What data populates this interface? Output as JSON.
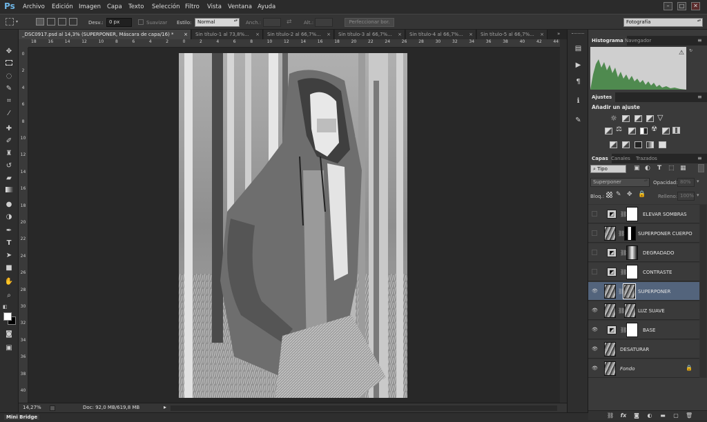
{
  "app": {
    "logo": "Ps"
  },
  "menu": [
    "Archivo",
    "Edición",
    "Imagen",
    "Capa",
    "Texto",
    "Selección",
    "Filtro",
    "Vista",
    "Ventana",
    "Ayuda"
  ],
  "window_controls": {
    "minimize": "–",
    "maximize": "□",
    "close": "✕"
  },
  "options_bar": {
    "feather_label": "Desv.:",
    "feather_value": "0 px",
    "antialias_label": "Suavizar",
    "style_label": "Estilo:",
    "style_value": "Normal",
    "width_label": "Anch.:",
    "height_label": "Alt.:",
    "refine_edge_button": "Perfeccionar bor.",
    "workspace_value": "Fotografía"
  },
  "doc_tabs": [
    {
      "label": "_DSC0917.psd al 14,3% (SUPERPONER, Máscara de capa/16) *",
      "close": "×"
    },
    {
      "label": "Sin título-1 al 73,8%...",
      "close": "×"
    },
    {
      "label": "Sin título-2 al 66,7%...",
      "close": "×"
    },
    {
      "label": "Sin título-3 al 66,7%...",
      "close": "×"
    },
    {
      "label": "Sin título-4 al 66,7%...",
      "close": "×"
    },
    {
      "label": "Sin título-5 al 66,7%...",
      "close": "×"
    }
  ],
  "ruler_h": [
    "18",
    "16",
    "14",
    "12",
    "10",
    "8",
    "6",
    "4",
    "2",
    "0",
    "2",
    "4",
    "6",
    "8",
    "10",
    "12",
    "14",
    "16",
    "18",
    "20",
    "22",
    "24",
    "26",
    "28",
    "30",
    "32",
    "34",
    "36",
    "38",
    "40",
    "42",
    "44"
  ],
  "ruler_v": [
    "0",
    "2",
    "4",
    "6",
    "8",
    "10",
    "12",
    "14",
    "16",
    "18",
    "20",
    "22",
    "24",
    "26",
    "28",
    "30",
    "32",
    "34",
    "36",
    "38",
    "40"
  ],
  "status": {
    "zoom": "14,27%",
    "doc_info": "Doc: 92,0 MB/619,8 MB"
  },
  "mini_bridge": "Mini Bridge",
  "histogram": {
    "tabs": [
      "Histograma",
      "Navegador"
    ],
    "warning": "⚠"
  },
  "adjustments": {
    "tab": "Ajustes",
    "title": "Añadir un ajuste",
    "row1": [
      "brightness-icon",
      "levels-icon",
      "curves-icon",
      "exposure-icon",
      "gradient-triangle-icon"
    ],
    "row2": [
      "vibrance-icon",
      "hue-icon",
      "color-balance-icon",
      "bw-icon",
      "photo-filter-icon",
      "channel-mixer-icon",
      "color-lookup-icon"
    ],
    "row3": [
      "invert-icon",
      "posterize-icon",
      "threshold-icon",
      "gradient-map-icon",
      "selective-color-icon"
    ]
  },
  "layers_panel": {
    "tabs": [
      "Capas",
      "Canales",
      "Trazados"
    ],
    "filter_kind": "Tipo",
    "blend_mode": "Superponer",
    "opacity_label": "Opacidad:",
    "opacity_value": "80%",
    "lock_label": "Bloq.:",
    "fill_label": "Relleno:",
    "fill_value": "100%",
    "layers": [
      {
        "name": "ELEVAR SOMBRAS",
        "visible": false,
        "kind": "adjustment"
      },
      {
        "name": "SUPERPONER CUERPO",
        "visible": false,
        "kind": "image"
      },
      {
        "name": "DEGRADADO",
        "visible": false,
        "kind": "adjustment"
      },
      {
        "name": "CONTRASTE",
        "visible": false,
        "kind": "adjustment"
      },
      {
        "name": "SUPERPONER",
        "visible": true,
        "kind": "image",
        "selected": true
      },
      {
        "name": "LUZ SUAVE",
        "visible": true,
        "kind": "image"
      },
      {
        "name": "BASE",
        "visible": true,
        "kind": "adjustment"
      },
      {
        "name": "DESATURAR",
        "visible": true,
        "kind": "image_only"
      },
      {
        "name": "Fondo",
        "visible": true,
        "kind": "background"
      }
    ]
  },
  "colors": {
    "accent": "#53647c",
    "ps_blue": "#6fb6e6"
  }
}
